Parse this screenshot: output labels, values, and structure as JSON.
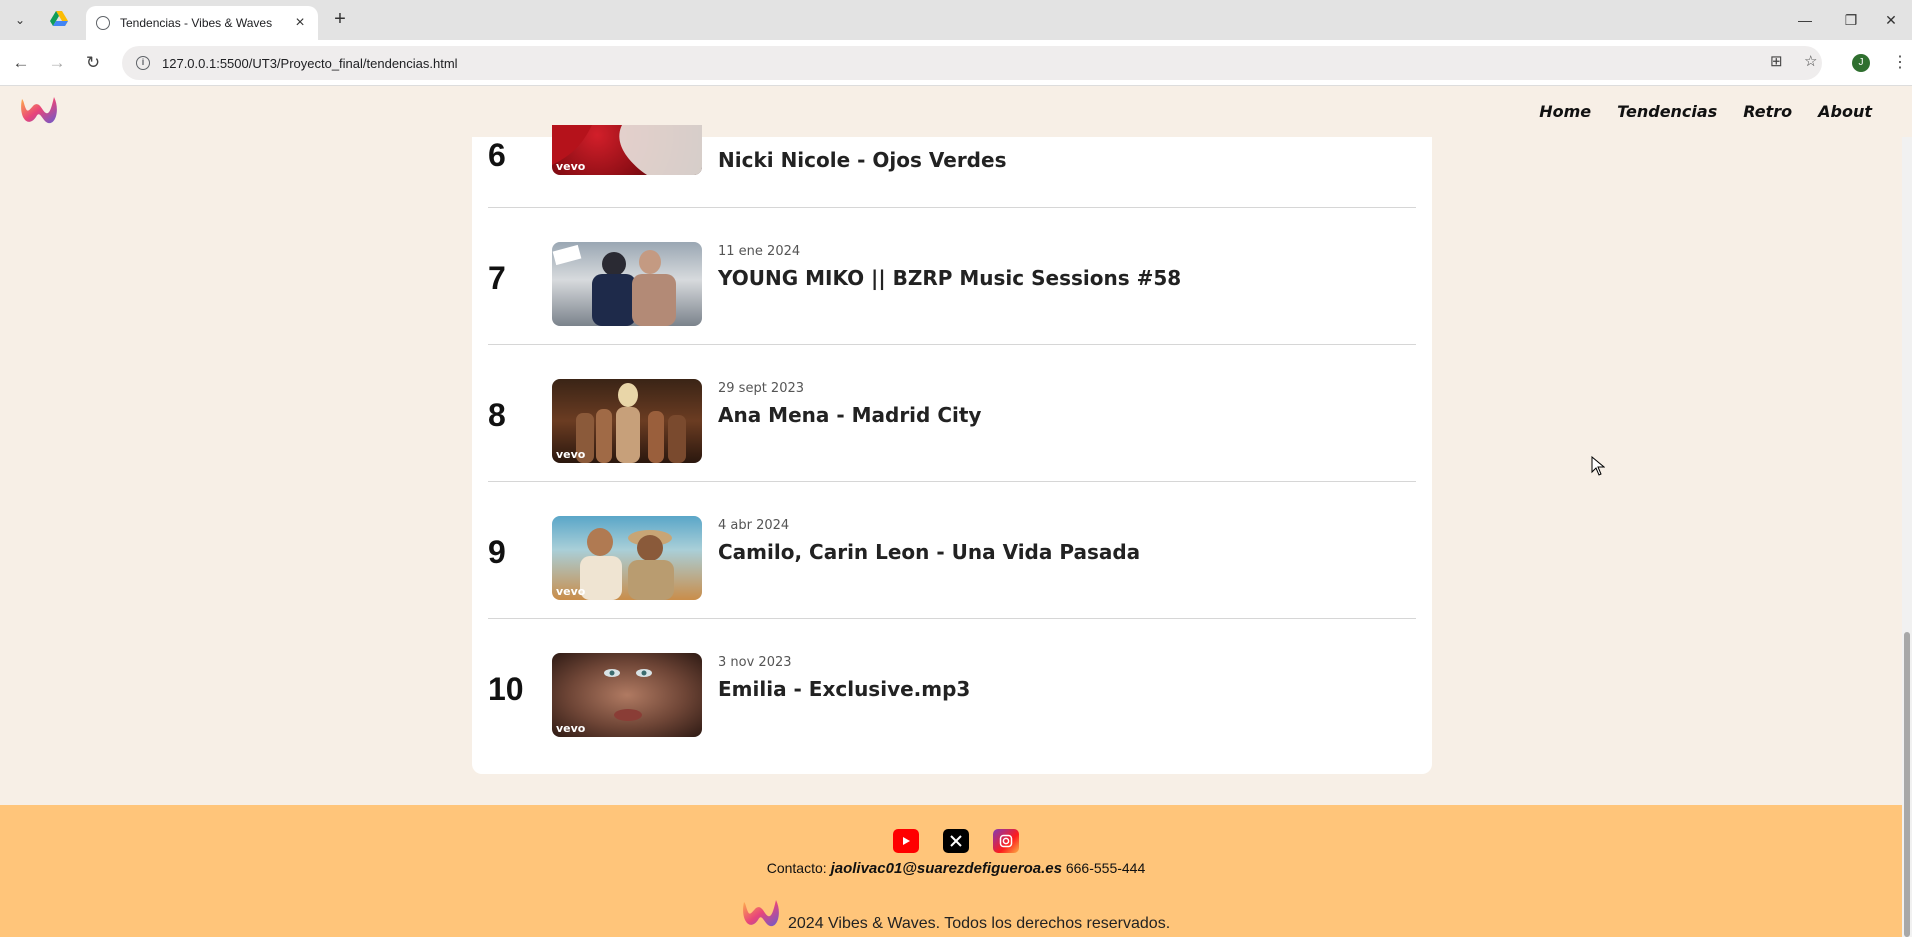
{
  "browser": {
    "tab_title": "Tendencias - Vibes & Waves",
    "url": "127.0.0.1:5500/UT3/Proyecto_final/tendencias.html",
    "profile_initial": "J"
  },
  "nav": {
    "items": [
      "Home",
      "Tendencias",
      "Retro",
      "About"
    ]
  },
  "songs": [
    {
      "rank": "6",
      "date": "",
      "title": "Nicki Nicole - Ojos Verdes",
      "vevo": "vevo"
    },
    {
      "rank": "7",
      "date": "11 ene 2024",
      "title": "YOUNG MIKO || BZRP Music Sessions #58",
      "vevo": ""
    },
    {
      "rank": "8",
      "date": "29 sept 2023",
      "title": "Ana Mena - Madrid City",
      "vevo": "vevo"
    },
    {
      "rank": "9",
      "date": "4 abr 2024",
      "title": "Camilo, Carin Leon - Una Vida Pasada",
      "vevo": "vevo"
    },
    {
      "rank": "10",
      "date": "3 nov 2023",
      "title": "Emilia - Exclusive.mp3",
      "vevo": "vevo"
    }
  ],
  "footer": {
    "contact_label": "Contacto:",
    "email": "jaolivac01@suarezdefigueroa.es",
    "phone": "666-555-444",
    "copyright": "2024 Vibes & Waves. Todos los derechos reservados.",
    "social_icons": [
      "youtube-icon",
      "x-icon",
      "instagram-icon"
    ]
  },
  "colors": {
    "page_bg": "#f7efe6",
    "footer_bg": "#ffc57a",
    "card_bg": "#ffffff"
  }
}
